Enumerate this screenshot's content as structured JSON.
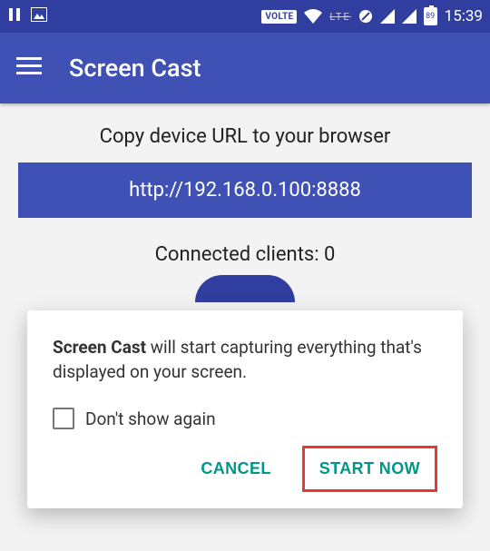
{
  "status": {
    "volte": "VOLTE",
    "lte": "LTE",
    "battery": "89",
    "time": "15:39"
  },
  "appbar": {
    "title": "Screen Cast"
  },
  "main": {
    "instruction": "Copy device URL to your browser",
    "url": "http://192.168.0.100:8888",
    "clients_label": "Connected clients: 0"
  },
  "dialog": {
    "strong": "Screen Cast",
    "rest": " will start capturing everything that's displayed on your screen.",
    "dont_show": "Don't show again",
    "cancel": "CANCEL",
    "start": "START NOW"
  }
}
